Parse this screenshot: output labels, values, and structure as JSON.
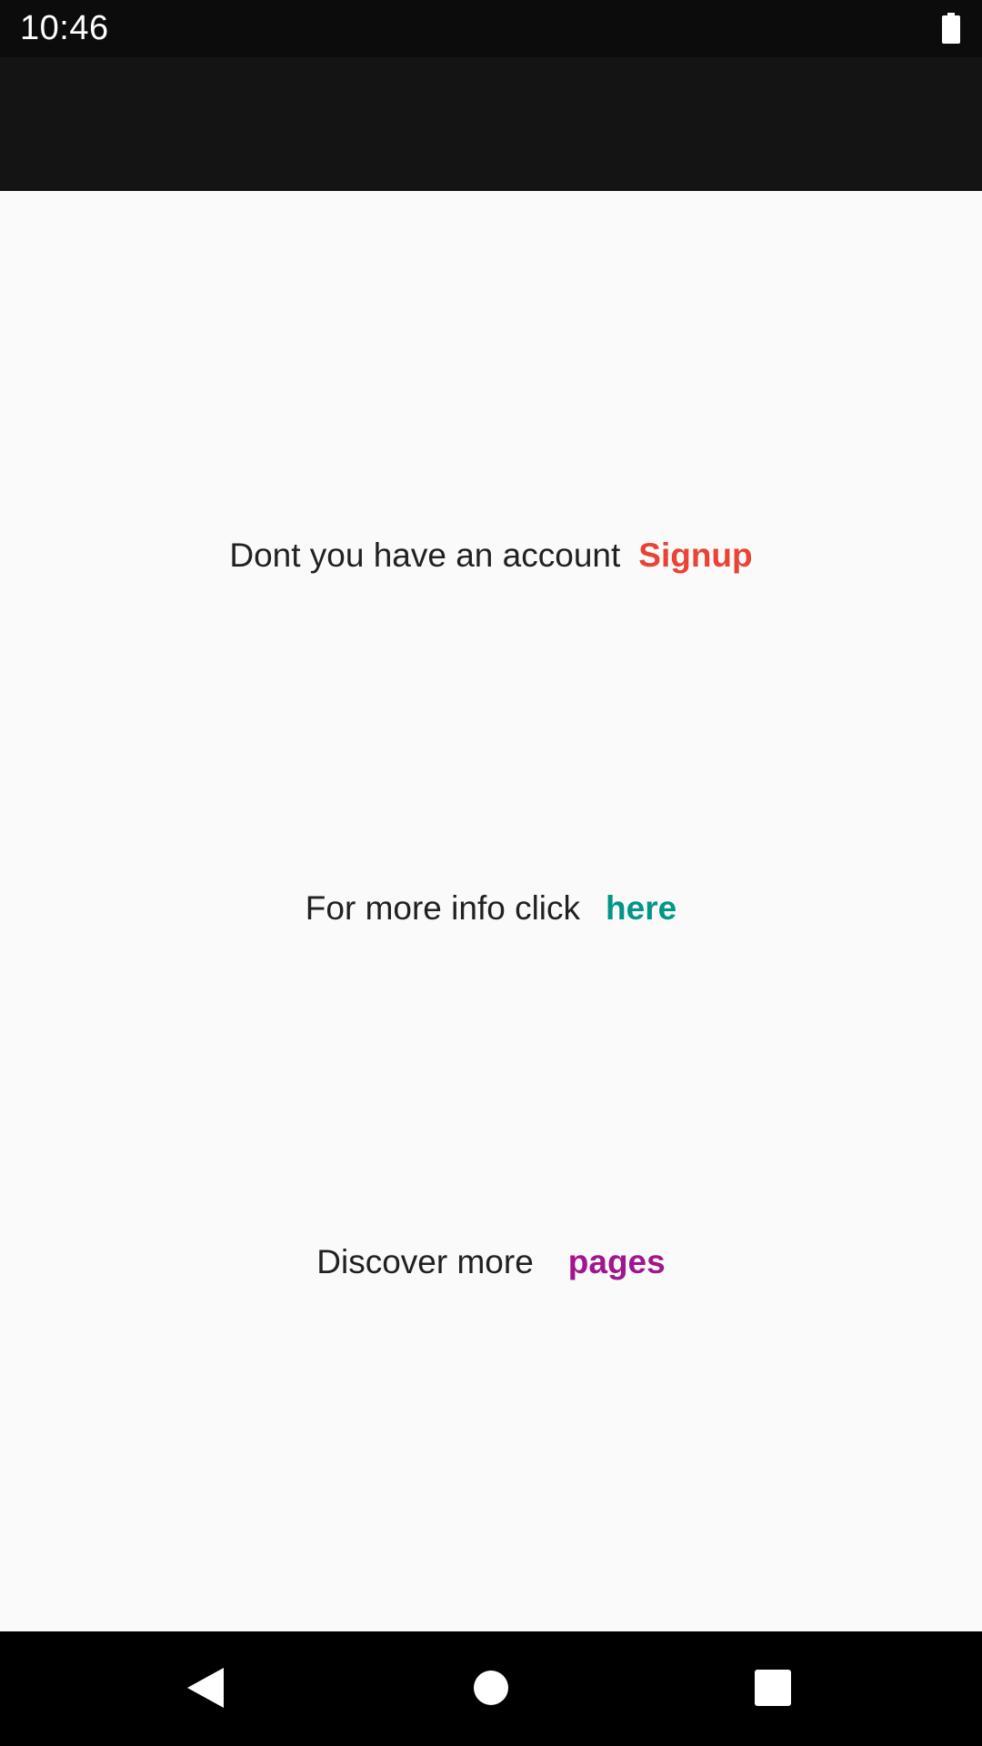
{
  "status_bar": {
    "time": "10:46",
    "battery_icon": "battery-full-icon"
  },
  "colors": {
    "signup": "#e84335",
    "here": "#009688",
    "pages": "#a0168f",
    "text": "#212121"
  },
  "rows": [
    {
      "text": "Dont you have an account",
      "link": "Signup"
    },
    {
      "text": "For more info click",
      "link": "here"
    },
    {
      "text": "Discover more",
      "link": "pages"
    }
  ],
  "nav_bar": {
    "back_icon": "back-triangle-icon",
    "home_icon": "home-circle-icon",
    "recents_icon": "recents-square-icon"
  }
}
